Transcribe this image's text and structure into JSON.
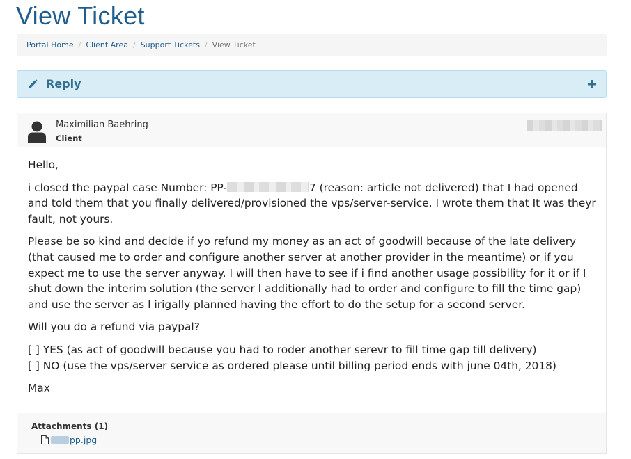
{
  "page": {
    "title": "View Ticket"
  },
  "breadcrumb": {
    "items": [
      "Portal Home",
      "Client Area",
      "Support Tickets"
    ],
    "active": "View Ticket",
    "separator": "/"
  },
  "reply": {
    "label": "Reply",
    "icon": "pencil-icon",
    "toggle_icon": "plus-icon"
  },
  "message": {
    "author": "Maximilian Baehring",
    "role": "Client",
    "greeting": "Hello,",
    "p1_before": "i closed the paypal case Number: PP-",
    "p1_after": "7 (reason: article not delivered) that I had opened and told them that you finally delivered/provisioned the vps/server-service. I wrote them that It was theyr fault, not yours.",
    "p2": "Please be so kind and decide if yo refund my money as an act of goodwill because of the late delivery (that caused me to order and configure another server at another provider in the meantime) or if you expect me to use the server anyway. I will then have to see if i find another usage possibility for it or if I shut down the interim solution (the server I additionally had to order and configure to fill the time gap) and use the server as I irigally planned having the effort to do the setup for a second server.",
    "question": "Will you do a refund via paypal?",
    "option_yes": "[ ] YES (as act of goodwill because you had to roder another serevr to fill time gap till delivery)",
    "option_no": "[ ] NO (use the vps/server service as ordered please until billing period ends with june 04th, 2018)",
    "signature": "Max"
  },
  "attachments": {
    "title": "Attachments (1)",
    "file_suffix": "pp.jpg"
  },
  "colors": {
    "title": "#1f5d8e",
    "link": "#1f5d8e",
    "reply_bg": "#d9edf7",
    "reply_text": "#31708f"
  }
}
